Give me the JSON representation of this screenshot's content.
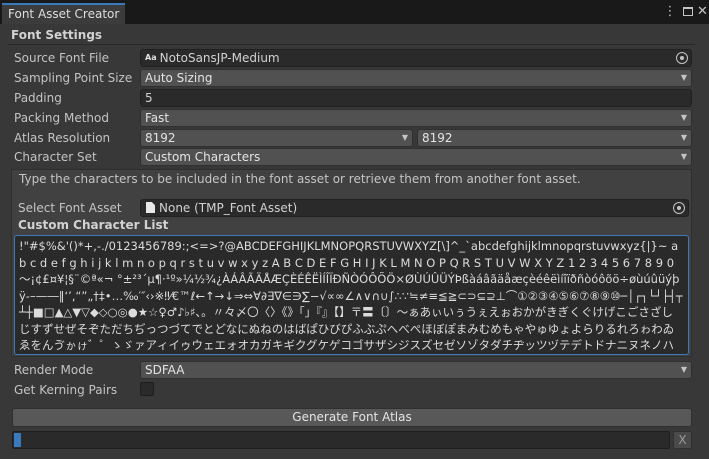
{
  "window": {
    "tab_title": "Font Asset Creator",
    "menu_glyph": "⋮",
    "close_glyph": "✕"
  },
  "section_title": "Font Settings",
  "fields": {
    "source_font": {
      "label": "Source Font File",
      "icon_text": "Aa",
      "value": "NotoSansJP-Medium"
    },
    "sampling": {
      "label": "Sampling Point Size",
      "value": "Auto Sizing"
    },
    "padding": {
      "label": "Padding",
      "value": "5"
    },
    "packing": {
      "label": "Packing Method",
      "value": "Fast"
    },
    "atlas": {
      "label": "Atlas Resolution",
      "width": "8192",
      "height": "8192"
    },
    "charset": {
      "label": "Character Set",
      "value": "Custom Characters"
    },
    "render_mode": {
      "label": "Render Mode",
      "value": "SDFAA"
    },
    "kerning": {
      "label": "Get Kerning Pairs",
      "checked": false
    }
  },
  "charset_panel": {
    "help_text": "Type the characters to be included in the font asset or retrieve them from another font asset.",
    "select_label": "Select Font Asset",
    "select_value": "None (TMP_Font Asset)",
    "custom_list_label": "Custom Character List",
    "custom_list_text": "!\"#$%&'()*+,-./0123456789:;<=>?@ABCDEFGHIJKLMNOPQRSTUVWXYZ[\\]^_`abcdefghijklmnopqrstuvwxyz{|}~ a b c d e f g h i j k l m n o p q r s t u v w x y z A B C D E F G H I J K L M N O P Q R S T U V W X Y Z 1 2 3 4 5 6 7 8 9 0 ～¡¢£¤¥¦§¨©ª«¬ °±²³´µ¶·¹º»¼½¾¿ÀÁÂÃÄÅÆÇÈÉÊËÌÍÎÏÐÑÒÓÔÕÖ×ØÙÚÛÜÝÞßàáâãäåæçèéêëìíîïðñòóôõö÷øùúûüýþÿ‐–—―‖‘’‚“”„†‡•…‰′″‹›※‼⁄€™ℓ←↑→↓⇒⇔∀∂∃∇∈∋∑−√∝∞∠∧∨∩∪∫∴∵≒≠≡≦≧⊂⊃⊆⊇⊥⌒①②③④⑤⑥⑦⑧⑨⑩─│┌┐└┘├┤┬┴┼■□▲△▼▽◆◇○◎●★☆♀♂♪♭♯、。〃々〆〇〈〉《》「」『』【】〒〓〔〕〜ぁあぃいぅうぇえぉおかがきぎくぐけげこごさざしじすずせぜそぞただちぢっつづてでとどなにぬねのはばぱひびぴふぶぷへべぺほぼぽまみむめもゃやゅゆょよらりるれろゎわゐゑをんゔゕゖ゛゜ゝゞァアィイゥウェエォオカガキギクグケゲコゴサザシジスズセゼソゾタダチヂッツヅテデトドナニヌネノハバパヒビピフブプヘベペホボポマミムメモャヤュユョヨラリルレロヮワヰヱヲンヴヵヶ・ーヽヾΑΒΓΔΕΖΗΘΙΚΛΜΝΞΟΠΡΣΤΥΦΧΨΩαβγδεζηθικλμνξοπρστυφχψωАБВГДЕЁЖЗИЙКЛМНОПРСТУФХЦЧШЩЪЫЬЭЮЯ"
  },
  "actions": {
    "generate_label": "Generate Font Atlas",
    "cancel_glyph": "X",
    "progress": 0.01
  },
  "colors": {
    "accent": "#3a79bb",
    "background": "#383838",
    "field": "#2a2a2a",
    "dropdown": "#515151"
  }
}
